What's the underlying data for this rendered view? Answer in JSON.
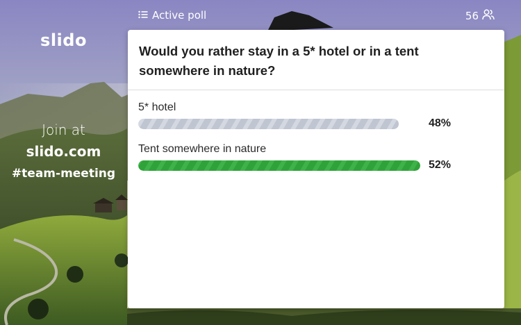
{
  "brand": {
    "logo_text": "slido"
  },
  "join": {
    "label": "Join at",
    "url": "slido.com",
    "event_code": "#team-meeting"
  },
  "header": {
    "active_poll_label": "Active poll",
    "participant_count": "56",
    "list_icon": "list-icon",
    "participants_icon": "people-icon"
  },
  "poll": {
    "question": "Would you rather stay in a 5* hotel or in a tent somewhere in nature?",
    "options": [
      {
        "label": "5* hotel",
        "percent_label": "48%",
        "percent": 48,
        "color": "#c3c9d4"
      },
      {
        "label": "Tent somewhere in nature",
        "percent_label": "52%",
        "percent": 52,
        "color": "#34a73e"
      }
    ]
  }
}
